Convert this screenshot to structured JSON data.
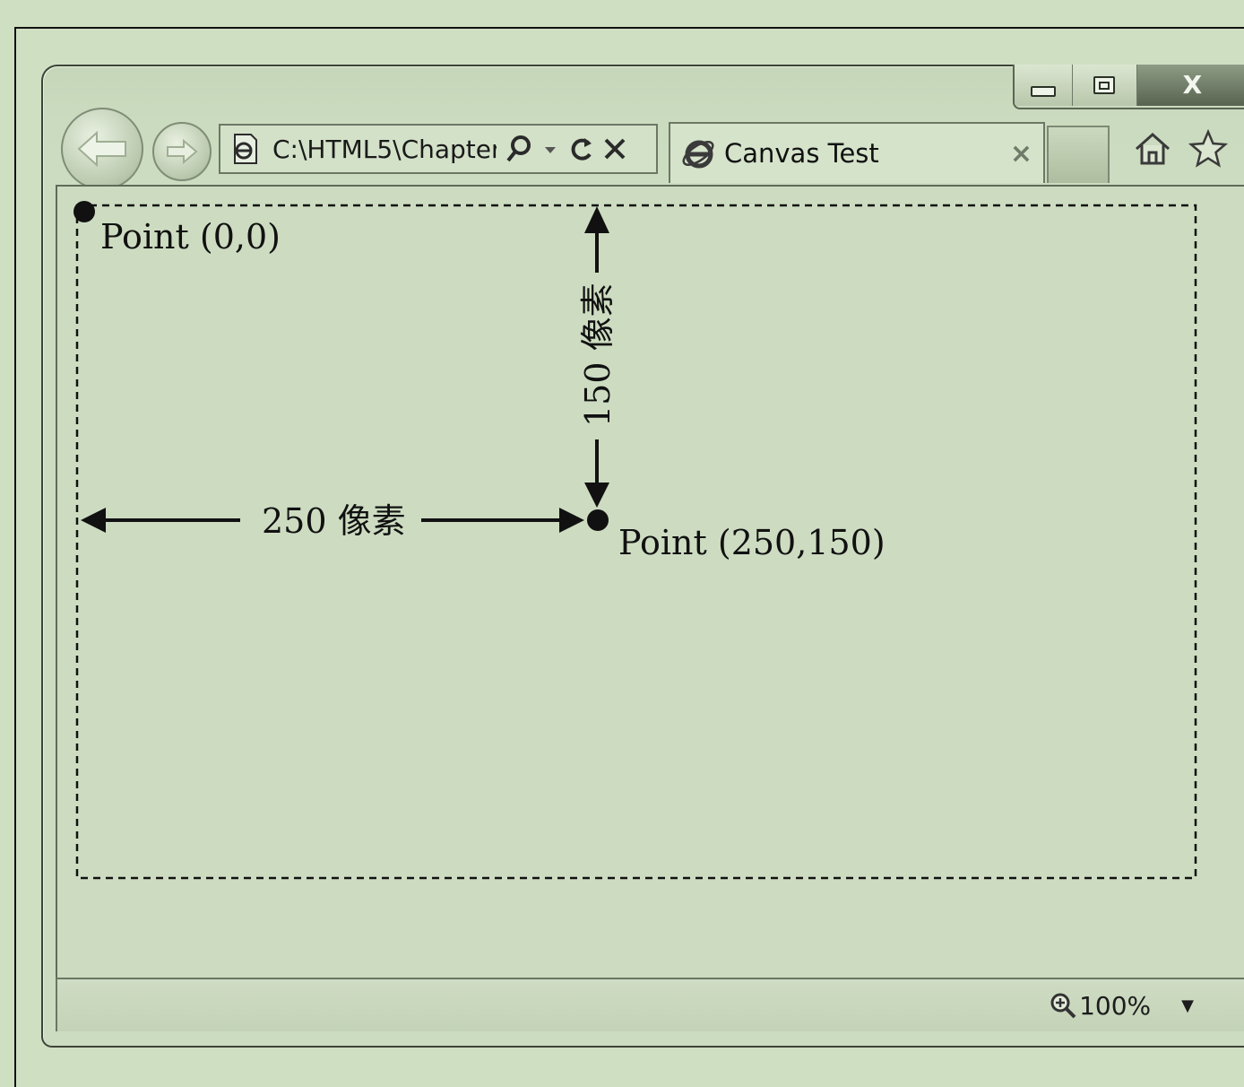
{
  "browser": {
    "address": "C:\\HTML5\\Chapter",
    "tab_title": "Canvas Test",
    "tab_close": "×",
    "zoom": "100%"
  },
  "canvas": {
    "origin_label": "Point (0,0)",
    "target_label": "Point (250,150)",
    "horizontal_label": "250 像素",
    "vertical_label": "150 像素"
  },
  "icons": {
    "back": "back-arrow-icon",
    "forward": "forward-arrow-icon",
    "search": "search-icon",
    "dropdown": "chevron-down-icon",
    "refresh": "refresh-icon",
    "stop": "close-icon",
    "home": "home-icon",
    "favorites": "star-icon",
    "zoom": "zoom-icon"
  }
}
